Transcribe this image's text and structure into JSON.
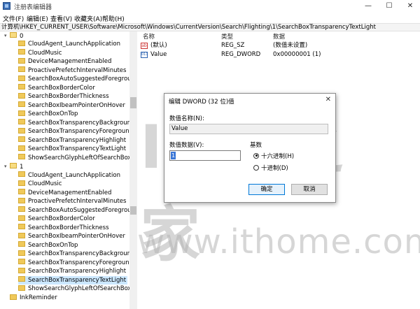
{
  "window": {
    "title": "注册表编辑器"
  },
  "menu": [
    "文件(F)",
    "编辑(E)",
    "查看(V)",
    "收藏夹(A)",
    "帮助(H)"
  ],
  "address": "计算机\\HKEY_CURRENT_USER\\Software\\Microsoft\\Windows\\CurrentVersion\\Search\\Flighting\\1\\SearchBoxTransparencyTextLight",
  "tree": {
    "group0_label": "0",
    "group0_items": [
      "CloudAgent_LaunchApplication",
      "CloudMusic",
      "DeviceManagementEnabled",
      "ProactivePrefetchIntervalMinutes",
      "SearchBoxAutoSuggestedForegroundCo",
      "SearchBoxBorderColor",
      "SearchBoxBorderThickness",
      "SearchBoxIbeamPointerOnHover",
      "SearchBoxOnTop",
      "SearchBoxTransparencyBackground",
      "SearchBoxTransparencyForeground",
      "SearchBoxTransparencyHighlight",
      "SearchBoxTransparencyTextLight",
      "ShowSearchGlyphLeftOfSearchBox"
    ],
    "group1_label": "1",
    "group1_items": [
      "CloudAgent_LaunchApplication",
      "CloudMusic",
      "DeviceManagementEnabled",
      "ProactivePrefetchIntervalMinutes",
      "SearchBoxAutoSuggestedForegroundCo",
      "SearchBoxBorderColor",
      "SearchBoxBorderThickness",
      "SearchBoxIbeamPointerOnHover",
      "SearchBoxOnTop",
      "SearchBoxTransparencyBackground",
      "SearchBoxTransparencyForeground",
      "SearchBoxTransparencyHighlight",
      "SearchBoxTransparencyTextLight",
      "ShowSearchGlyphLeftOfSearchBox"
    ],
    "last_item": "InkReminder",
    "selected_item": "SearchBoxTransparencyTextLight"
  },
  "list": {
    "headers": [
      "名称",
      "类型",
      "数据"
    ],
    "rows": [
      {
        "name": "(默认)",
        "type": "REG_SZ",
        "data": "(数值未设置)",
        "icon": "string-value-icon"
      },
      {
        "name": "Value",
        "type": "REG_DWORD",
        "data": "0x00000001 (1)",
        "icon": "binary-value-icon"
      }
    ]
  },
  "dialog": {
    "title": "编辑 DWORD (32 位)值",
    "value_name_label": "数值名称(N):",
    "value_name": "Value",
    "value_data_label": "数值数据(V):",
    "value_data": "1",
    "base_label": "基数",
    "hex_label": "十六进制(H)",
    "dec_label": "十进制(D)",
    "selected_base": "hex",
    "ok_label": "确定",
    "cancel_label": "取消"
  },
  "watermark": {
    "text": "www.ithome.com"
  },
  "colors": {
    "selection": "#cce8ff",
    "primary_button_border": "#0078d7"
  }
}
